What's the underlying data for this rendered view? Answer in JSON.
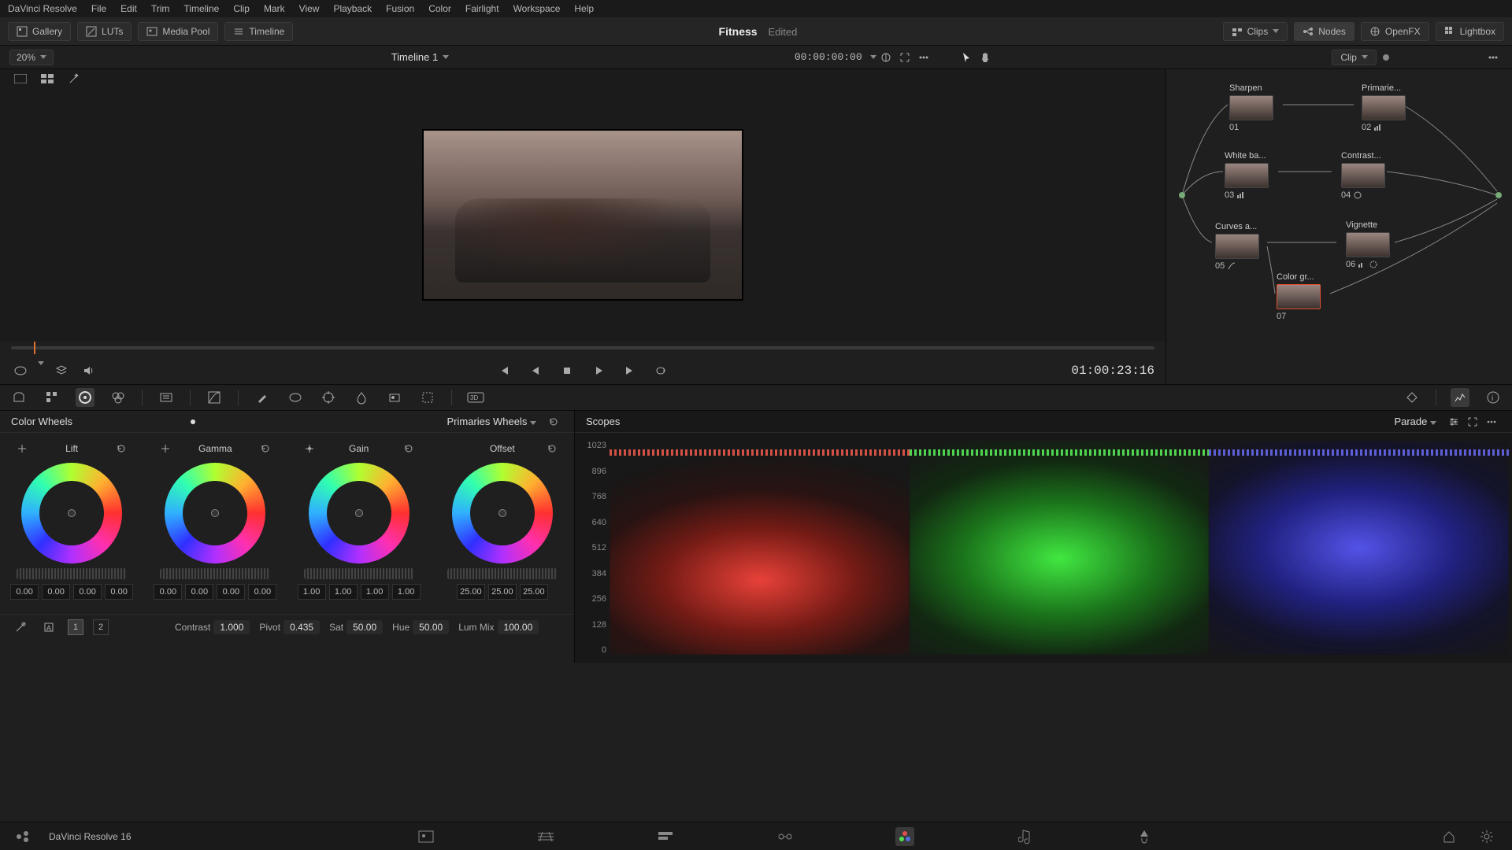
{
  "app": {
    "name": "DaVinci Resolve",
    "version_label": "DaVinci Resolve 16"
  },
  "menubar": [
    "DaVinci Resolve",
    "File",
    "Edit",
    "Trim",
    "Timeline",
    "Clip",
    "Mark",
    "View",
    "Playback",
    "Fusion",
    "Color",
    "Fairlight",
    "Workspace",
    "Help"
  ],
  "toolbar": {
    "left": [
      {
        "icon": "gallery",
        "label": "Gallery"
      },
      {
        "icon": "luts",
        "label": "LUTs"
      },
      {
        "icon": "mediapool",
        "label": "Media Pool"
      },
      {
        "icon": "timeline",
        "label": "Timeline"
      }
    ],
    "project_title": "Fitness",
    "project_status": "Edited",
    "right": [
      {
        "icon": "clips",
        "label": "Clips"
      },
      {
        "icon": "nodes",
        "label": "Nodes",
        "active": true
      },
      {
        "icon": "openfx",
        "label": "OpenFX"
      },
      {
        "icon": "lightbox",
        "label": "Lightbox"
      }
    ]
  },
  "subbar": {
    "zoom": "20%",
    "timeline": "Timeline 1",
    "timecode": "00:00:00:00",
    "node_scope": "Clip"
  },
  "transport": {
    "timecode": "01:00:23:16"
  },
  "nodes": [
    {
      "num": "01",
      "label": "Sharpen",
      "row": 0,
      "col": 0
    },
    {
      "num": "02",
      "label": "Primarie...",
      "row": 0,
      "col": 1
    },
    {
      "num": "03",
      "label": "White ba...",
      "row": 1,
      "col": 0
    },
    {
      "num": "04",
      "label": "Contrast...",
      "row": 1,
      "col": 1
    },
    {
      "num": "05",
      "label": "Curves a...",
      "row": 2,
      "col": 0
    },
    {
      "num": "06",
      "label": "Vignette",
      "row": 2,
      "col": 1
    },
    {
      "num": "07",
      "label": "Color gr...",
      "row": 3,
      "col": 0,
      "selected": true
    }
  ],
  "wheels_panel": {
    "title": "Color Wheels",
    "mode": "Primaries Wheels",
    "wheels": [
      {
        "name": "Lift",
        "values": [
          "0.00",
          "0.00",
          "0.00",
          "0.00"
        ]
      },
      {
        "name": "Gamma",
        "values": [
          "0.00",
          "0.00",
          "0.00",
          "0.00"
        ]
      },
      {
        "name": "Gain",
        "values": [
          "1.00",
          "1.00",
          "1.00",
          "1.00"
        ]
      },
      {
        "name": "Offset",
        "values": [
          "25.00",
          "25.00",
          "25.00"
        ]
      }
    ],
    "pages": [
      "1",
      "2"
    ],
    "adjustments": [
      {
        "label": "Contrast",
        "value": "1.000"
      },
      {
        "label": "Pivot",
        "value": "0.435"
      },
      {
        "label": "Sat",
        "value": "50.00"
      },
      {
        "label": "Hue",
        "value": "50.00"
      },
      {
        "label": "Lum Mix",
        "value": "100.00"
      }
    ]
  },
  "scopes": {
    "title": "Scopes",
    "mode": "Parade",
    "y_ticks": [
      "1023",
      "896",
      "768",
      "640",
      "512",
      "384",
      "256",
      "128",
      "0"
    ]
  }
}
